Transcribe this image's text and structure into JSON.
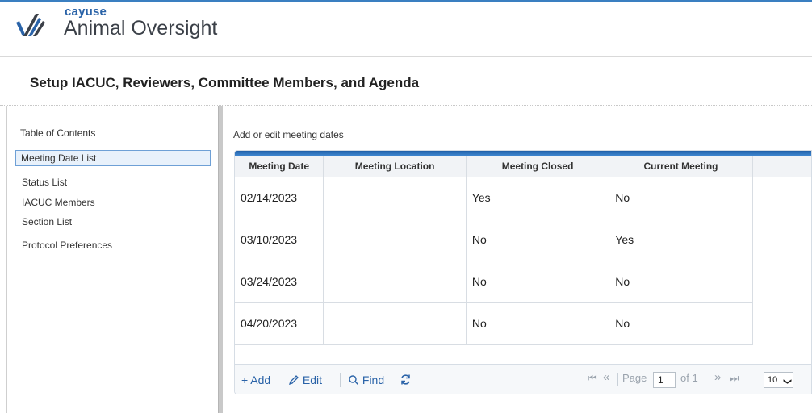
{
  "brand": {
    "small": "cayuse",
    "product": "Animal Oversight"
  },
  "page": {
    "title": "Setup IACUC, Reviewers, Committee Members, and Agenda"
  },
  "sidebar": {
    "title": "Table of Contents",
    "items": [
      {
        "label": "Meeting Date List",
        "active": true
      },
      {
        "label": "Status List"
      },
      {
        "label": "IACUC Members"
      },
      {
        "label": "Section List"
      },
      {
        "label": "Protocol Preferences"
      }
    ]
  },
  "main": {
    "subtitle": "Add or edit meeting dates",
    "table": {
      "headers": [
        "Meeting Date",
        "Meeting Location",
        "Meeting Closed",
        "Current Meeting"
      ],
      "rows": [
        [
          "02/14/2023",
          "",
          "Yes",
          "No"
        ],
        [
          "03/10/2023",
          "",
          "No",
          "Yes"
        ],
        [
          "03/24/2023",
          "",
          "No",
          "No"
        ],
        [
          "04/20/2023",
          "",
          "No",
          "No"
        ]
      ]
    },
    "toolbar": {
      "add": "+ Add",
      "edit": "Edit",
      "find": "Find",
      "edit_icon": "pencil-icon",
      "find_icon": "search-icon",
      "refresh_icon": "refresh-icon"
    },
    "pager": {
      "first": "⏮",
      "prev": "«",
      "page_label": "Page",
      "page_value": "1",
      "of_label": "of 1",
      "next": "»",
      "last": "⏭",
      "page_size": "10"
    }
  },
  "colors": {
    "accent": "#2a63a8",
    "topbar": "#1f5fa8",
    "active_bg": "#e8f1fb"
  }
}
